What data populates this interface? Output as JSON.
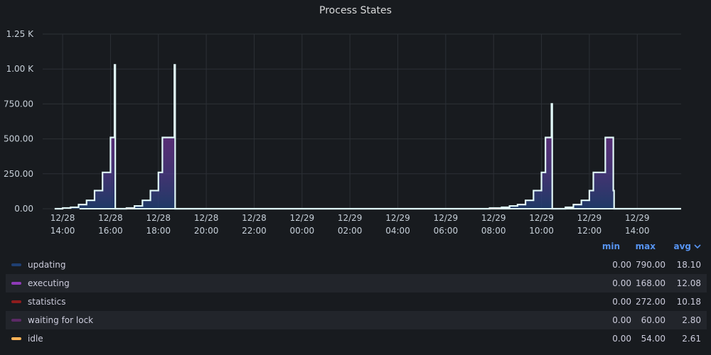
{
  "panel": {
    "title": "Process States"
  },
  "chart_data": {
    "type": "area",
    "title": "Process States",
    "y_ticks": [
      "0.00",
      "250.00",
      "500.00",
      "750.00",
      "1.00 K",
      "1.25 K"
    ],
    "ylim": [
      0,
      1250
    ],
    "x_ticks": [
      {
        "date": "12/28",
        "time": "14:00"
      },
      {
        "date": "12/28",
        "time": "16:00"
      },
      {
        "date": "12/28",
        "time": "18:00"
      },
      {
        "date": "12/28",
        "time": "20:00"
      },
      {
        "date": "12/28",
        "time": "22:00"
      },
      {
        "date": "12/29",
        "time": "00:00"
      },
      {
        "date": "12/29",
        "time": "02:00"
      },
      {
        "date": "12/29",
        "time": "04:00"
      },
      {
        "date": "12/29",
        "time": "06:00"
      },
      {
        "date": "12/29",
        "time": "08:00"
      },
      {
        "date": "12/29",
        "time": "10:00"
      },
      {
        "date": "12/29",
        "time": "12:00"
      },
      {
        "date": "12/29",
        "time": "14:00"
      }
    ],
    "xlim": [
      "12/28 13:10",
      "12/29 15:50"
    ],
    "grid": true,
    "legend_position": "bottom",
    "series": [
      {
        "name": "updating",
        "color": "#1f3f72"
      },
      {
        "name": "executing",
        "color": "#8f3bb8"
      },
      {
        "name": "statistics",
        "color": "#8e1d1d"
      },
      {
        "name": "waiting for lock",
        "color": "#5c2a66"
      },
      {
        "name": "idle",
        "color": "#ffb357"
      }
    ],
    "total_line": {
      "color": "#e0f7f7",
      "points": [
        [
          "12/28 13:40",
          0
        ],
        [
          "12/28 14:00",
          5
        ],
        [
          "12/28 14:20",
          10
        ],
        [
          "12/28 14:40",
          30
        ],
        [
          "12/28 15:00",
          60
        ],
        [
          "12/28 15:20",
          130
        ],
        [
          "12/28 15:40",
          260
        ],
        [
          "12/28 16:00",
          510
        ],
        [
          "12/28 16:10",
          1030
        ],
        [
          "12/28 16:12",
          0
        ],
        [
          "12/28 16:40",
          5
        ],
        [
          "12/28 17:00",
          20
        ],
        [
          "12/28 17:20",
          60
        ],
        [
          "12/28 17:40",
          130
        ],
        [
          "12/28 18:00",
          260
        ],
        [
          "12/28 18:10",
          510
        ],
        [
          "12/28 18:40",
          1030
        ],
        [
          "12/28 18:42",
          0
        ],
        [
          "12/29 07:50",
          5
        ],
        [
          "12/29 08:20",
          10
        ],
        [
          "12/29 08:40",
          20
        ],
        [
          "12/29 09:00",
          30
        ],
        [
          "12/29 09:20",
          60
        ],
        [
          "12/29 09:40",
          130
        ],
        [
          "12/29 10:00",
          260
        ],
        [
          "12/29 10:10",
          510
        ],
        [
          "12/29 10:25",
          750
        ],
        [
          "12/29 10:27",
          0
        ],
        [
          "12/29 11:00",
          10
        ],
        [
          "12/29 11:20",
          30
        ],
        [
          "12/29 11:40",
          60
        ],
        [
          "12/29 12:00",
          130
        ],
        [
          "12/29 12:10",
          260
        ],
        [
          "12/29 12:40",
          510
        ],
        [
          "12/29 13:00",
          130
        ],
        [
          "12/29 13:02",
          0
        ],
        [
          "12/29 15:50",
          0
        ]
      ]
    }
  },
  "legend": {
    "headers": {
      "min": "min",
      "max": "max",
      "avg": "avg"
    },
    "sort_icon": "chevron-down-icon",
    "rows": [
      {
        "name": "updating",
        "color": "#1f3f72",
        "min": "0.00",
        "max": "790.00",
        "avg": "18.10"
      },
      {
        "name": "executing",
        "color": "#8f3bb8",
        "min": "0.00",
        "max": "168.00",
        "avg": "12.08"
      },
      {
        "name": "statistics",
        "color": "#8e1d1d",
        "min": "0.00",
        "max": "272.00",
        "avg": "10.18"
      },
      {
        "name": "waiting for lock",
        "color": "#5c2a66",
        "min": "0.00",
        "max": "60.00",
        "avg": "2.80"
      },
      {
        "name": "idle",
        "color": "#ffb357",
        "min": "0.00",
        "max": "54.00",
        "avg": "2.61"
      }
    ]
  }
}
